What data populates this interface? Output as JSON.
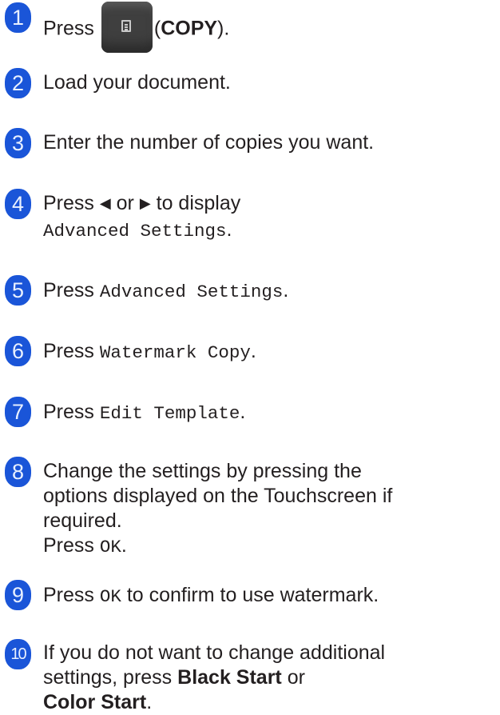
{
  "steps": [
    {
      "num": "1",
      "press": "Press",
      "open": "(",
      "copy": "COPY",
      "close": ")."
    },
    {
      "num": "2",
      "text": "Load your document."
    },
    {
      "num": "3",
      "text": "Enter the number of copies you want."
    },
    {
      "num": "4",
      "press": "Press",
      "left_arrow": "◀",
      "or": "or",
      "right_arrow": "▶",
      "to_display": "to display",
      "option": "Advanced Settings",
      "dot": "."
    },
    {
      "num": "5",
      "press": "Press",
      "option": "Advanced Settings",
      "dot": "."
    },
    {
      "num": "6",
      "press": "Press",
      "option": "Watermark Copy",
      "dot": "."
    },
    {
      "num": "7",
      "press": "Press",
      "option": "Edit Template",
      "dot": "."
    },
    {
      "num": "8",
      "line1": "Change the settings by pressing the",
      "line2": "options displayed on the Touchscreen if",
      "line3": "required.",
      "press": "Press",
      "ok": "OK",
      "dot": "."
    },
    {
      "num": "9",
      "press": "Press",
      "ok": "OK",
      "rest": "to confirm to use watermark."
    },
    {
      "num": "10",
      "line1": "If you do not want to change additional",
      "line2a": "settings, press",
      "black_start": "Black Start",
      "or": "or",
      "color_start": "Color Start",
      "dot": "."
    }
  ]
}
